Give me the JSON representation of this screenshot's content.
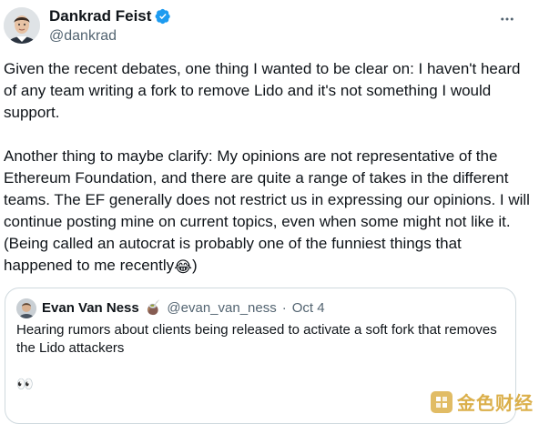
{
  "author": {
    "name": "Dankrad Feist",
    "handle": "@dankrad",
    "verified": true
  },
  "more_icon": "more-horizontal-icon",
  "tweet": {
    "paragraph1": "Given the recent debates, one thing I wanted to be clear on: I haven't heard of any team writing a fork to remove Lido and it's not something I would support.",
    "paragraph2": "Another thing to maybe clarify: My opinions are not representative of the Ethereum Foundation, and there are quite a range of takes in the different teams. The EF generally does not restrict us in expressing our opinions. I will continue posting mine on current topics, even when some might not like it. (Being called an autocrat is probably one of the funniest things that happened to me recently",
    "emoji": "😂",
    "paragraph2_end": ")"
  },
  "quote": {
    "name": "Evan Van Ness",
    "name_emoji": "🧉",
    "handle": "@evan_van_ness",
    "separator": "·",
    "date": "Oct 4",
    "text": "Hearing rumors about clients being released to activate a soft fork that removes the Lido attackers",
    "trailing_emoji": "👀"
  },
  "watermark": {
    "text": "金色财经"
  },
  "colors": {
    "text": "#0f1419",
    "secondary": "#536471",
    "verified": "#1d9bf0",
    "border": "#cfd9de",
    "watermark": "#d8a93b"
  }
}
